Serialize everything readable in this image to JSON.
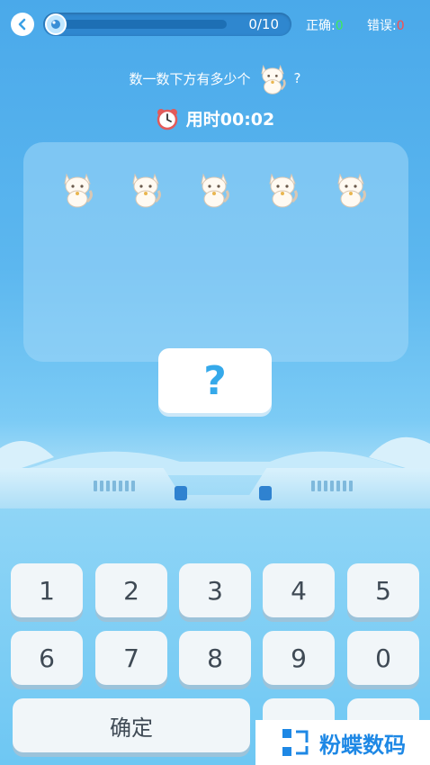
{
  "header": {
    "progress_text": "0/10",
    "progress_fraction": 0.03,
    "correct_label": "正确:",
    "correct_value": "0",
    "wrong_label": "错误:",
    "wrong_value": "0"
  },
  "question": {
    "prompt": "数一数下方有多少个",
    "suffix": "?"
  },
  "timer": {
    "label": "用时00:02"
  },
  "cats": [
    "cat",
    "cat",
    "cat",
    "cat",
    "cat"
  ],
  "answer": {
    "placeholder": "?"
  },
  "keypad": {
    "row1": [
      "1",
      "2",
      "3",
      "4",
      "5"
    ],
    "row2": [
      "6",
      "7",
      "8",
      "9",
      "0"
    ],
    "confirm_label": "确定"
  },
  "watermark": {
    "text": "粉蝶数码"
  },
  "icons": {
    "back": "back-arrow-icon",
    "timer": "alarm-clock-icon",
    "cat": "white-cat-icon"
  },
  "colors": {
    "correct": "#3dea5b",
    "wrong": "#ff4b4b",
    "accent": "#35a9ea"
  }
}
